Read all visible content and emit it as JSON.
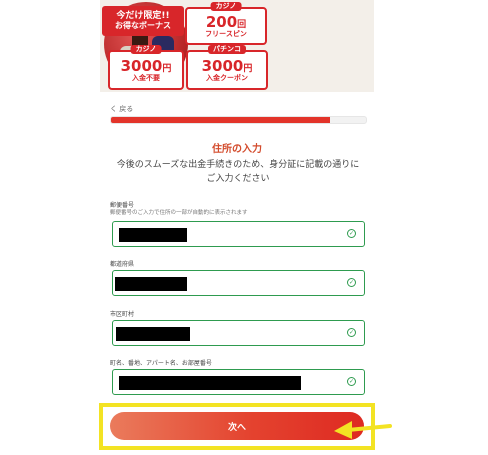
{
  "banner": {
    "ribbon_line1": "今だけ限定!!",
    "ribbon_line2": "お得なボーナス",
    "promos": [
      {
        "tag": "カジノ",
        "big": "200",
        "big_unit": "回",
        "sub": "フリースピン"
      },
      {
        "tag": "カジノ",
        "big": "3000",
        "big_unit": "円",
        "sub": "入金不要"
      },
      {
        "tag": "パチンコ",
        "big": "3000",
        "big_unit": "円",
        "sub": "入金クーポン"
      }
    ]
  },
  "nav": {
    "back_label": "く 戻る"
  },
  "progress": {
    "fraction": 0.86
  },
  "form": {
    "title": "住所の入力",
    "description": "今後のスムーズな出金手続きのため、身分証に記載の通りにご入力ください",
    "fields": [
      {
        "label": "郵便番号",
        "hint": "郵便番号のご入力で住所の一部が自動的に表示されます"
      },
      {
        "label": "都道府県"
      },
      {
        "label": "市区町村"
      },
      {
        "label": "町名、番地、アパート名、お部屋番号"
      }
    ],
    "next_label": "次へ"
  },
  "icons": {
    "field_check": "check-circle-icon",
    "pointer": "arrow-left-icon"
  },
  "colors": {
    "accent": "#e3342a",
    "valid": "#2e9b4f",
    "highlight": "#f3e323",
    "title": "#d34b2c"
  }
}
